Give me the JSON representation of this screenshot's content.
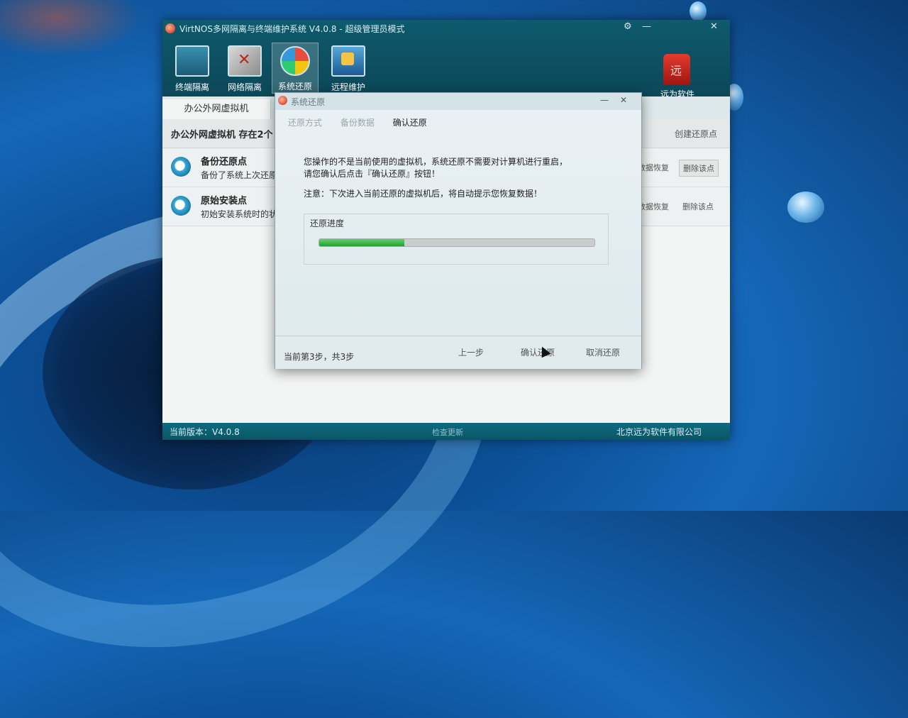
{
  "app": {
    "title": "VirtNOS多网隔离与终端维护系统 V4.0.8 - 超级管理员模式",
    "controls": [
      "⚙",
      "—",
      "✕"
    ]
  },
  "toolbar": [
    {
      "label": "终端隔离",
      "icon": "monitor-icon"
    },
    {
      "label": "网络隔离",
      "icon": "tools-icon"
    },
    {
      "label": "系统还原",
      "icon": "restore-icon",
      "active": true
    },
    {
      "label": "远程维护",
      "icon": "remote-monitor-icon"
    }
  ],
  "brand": {
    "name": "远为软件",
    "logo_glyph": "远"
  },
  "tabs": [
    {
      "label": "办公外网虚拟机"
    }
  ],
  "vm_header": {
    "text": "办公外网虚拟机 存在2个",
    "create_label": "创建还原点"
  },
  "restore_points": [
    {
      "title": "备份还原点",
      "desc": "备份了系统上次还原",
      "restore_label": "数据恢复",
      "delete_label": "删除该点"
    },
    {
      "title": "原始安装点",
      "desc": "初始安装系统时的状",
      "restore_label": "数据恢复",
      "delete_label": "删除该点"
    }
  ],
  "status": {
    "version": "当前版本：V4.0.8",
    "middle": "检查更新",
    "company": "北京远为软件有限公司"
  },
  "dialog": {
    "title": "系统还原",
    "controls": [
      "—",
      "✕"
    ],
    "steps": [
      "还原方式",
      "备份数据",
      "确认还原"
    ],
    "current_step": 2,
    "message_line1": "您操作的不是当前使用的虚拟机，系统还原不需要对计算机进行重启，",
    "message_line2": "请您确认后点击『确认还原』按钮！",
    "notice": "注意：下次进入当前还原的虚拟机后，将自动提示您恢复数据！",
    "progress_label": "还原进度",
    "progress_fraction": 0.31,
    "step_info": "当前第3步，共3步",
    "buttons": {
      "prev": "上一步",
      "confirm": "确认还原",
      "cancel": "取消还原"
    }
  }
}
